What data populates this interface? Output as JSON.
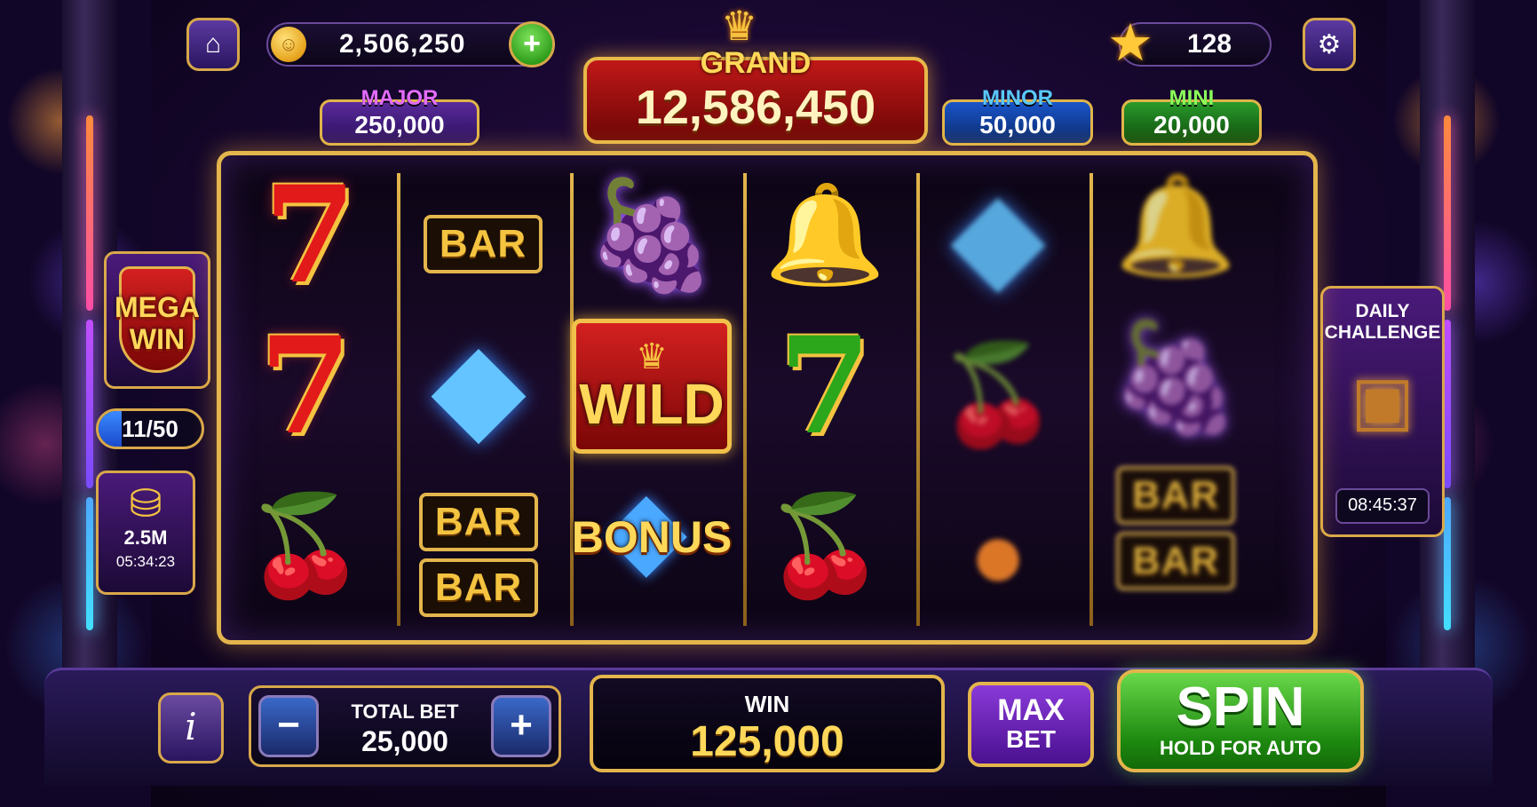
{
  "header": {
    "coins": "2,506,250",
    "coin_symbol": "☺",
    "add_label": "+",
    "stars": "128",
    "home_icon": "house-icon",
    "settings_icon": "gear-icon"
  },
  "jackpots": {
    "grand_label": "GRAND",
    "grand_value": "12,586,450",
    "major_label": "MAJOR",
    "major_value": "250,000",
    "minor_label": "MINOR",
    "minor_value": "50,000",
    "mini_label": "MINI",
    "mini_value": "20,000"
  },
  "reels": {
    "reel1": [
      "red-seven",
      "red-seven",
      "cherries"
    ],
    "reel2": [
      "bar",
      "blue-diamond",
      "double-bar"
    ],
    "reel3": [
      "grapes",
      "wild",
      "bonus"
    ],
    "reel4": [
      "bell",
      "green-seven",
      "cherries"
    ],
    "reel5": [
      "blue-diamond",
      "cherries",
      "peach"
    ],
    "reel6": [
      "bell",
      "grapes",
      "double-bar"
    ],
    "seven_text": "7",
    "bar_text": "BAR",
    "wild_text": "WILD",
    "bonus_text": "BONUS"
  },
  "left_panel": {
    "mega_win_line1": "MEGA",
    "mega_win_line2": "WIN",
    "progress_text": "11/50",
    "progress_fraction": 0.22,
    "coins_bonus": "2.5M",
    "coins_timer": "05:34:23"
  },
  "right_panel": {
    "daily_title_line1": "DAILY",
    "daily_title_line2": "CHALLENGE",
    "daily_timer": "08:45:37"
  },
  "console": {
    "info_label": "i",
    "bet_minus": "−",
    "bet_plus": "+",
    "total_bet_label": "TOTAL BET",
    "total_bet_value": "25,000",
    "win_label": "WIN",
    "win_value": "125,000",
    "max_bet_line1": "MAX",
    "max_bet_line2": "BET",
    "spin_label": "SPIN",
    "spin_sub": "HOLD FOR AUTO"
  },
  "colors": {
    "gold": "#e3b54c",
    "grand_red": "#c11818",
    "spin_green": "#2b9a18",
    "accent_purple": "#5b3aa0"
  }
}
